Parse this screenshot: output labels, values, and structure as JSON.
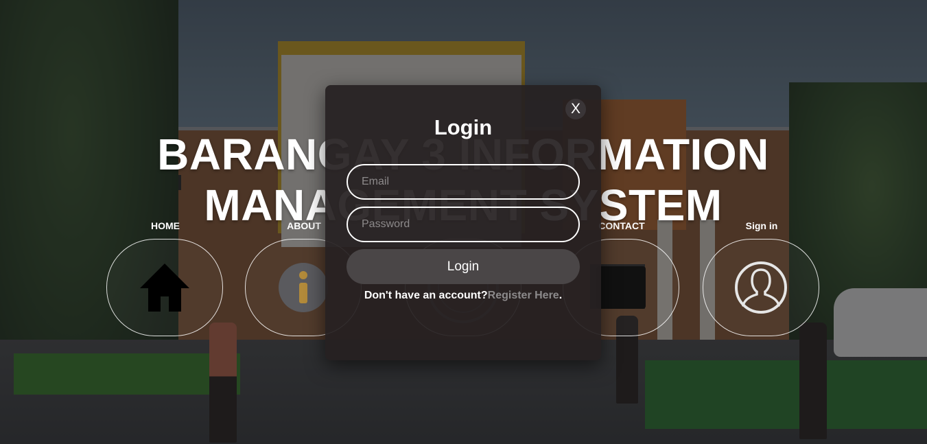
{
  "hero": {
    "title_line1": "BARANGAY 3 INFORMATION",
    "title_line2": "MANAGEMENT SYSTEM"
  },
  "nav": {
    "items": [
      {
        "label": "HOME",
        "icon": "home-icon"
      },
      {
        "label": "ABOUT",
        "icon": "info-icon"
      },
      {
        "label": "",
        "icon": "seal-icon"
      },
      {
        "label": "CONTACT",
        "icon": "contact-icon"
      },
      {
        "label": "Sign in",
        "icon": "user-icon"
      }
    ]
  },
  "login_modal": {
    "close_label": "X",
    "title": "Login",
    "email_placeholder": "Email",
    "password_placeholder": "Password",
    "submit_label": "Login",
    "footer_text": "Don't have an account?",
    "register_link": "Register Here",
    "footer_end": "."
  },
  "colors": {
    "modal_bg": "#262021",
    "button_bg": "#4a4647",
    "link": "#8c8a8b",
    "text": "#ffffff"
  }
}
